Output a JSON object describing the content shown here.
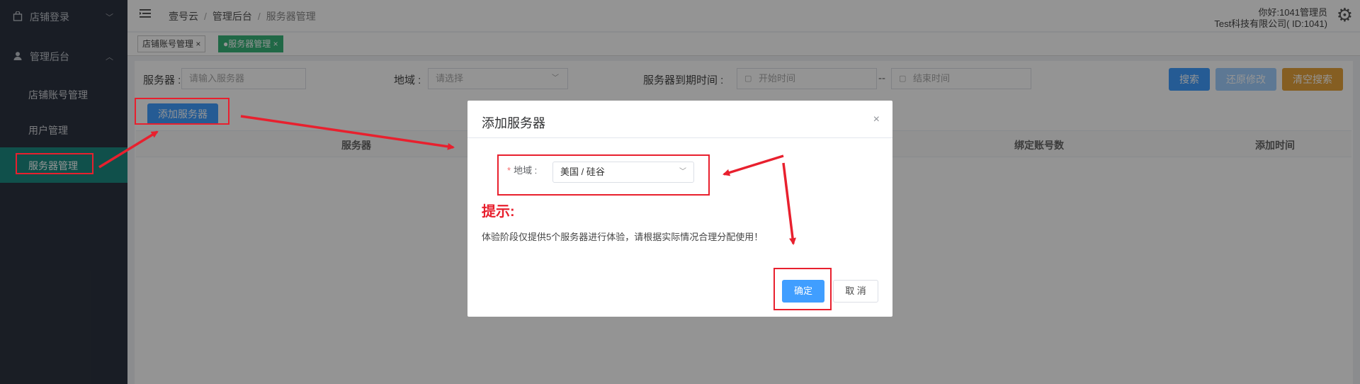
{
  "sidebar": {
    "groups": [
      {
        "label": "店铺登录",
        "icon": "bag-icon"
      },
      {
        "label": "管理后台",
        "icon": "user-icon"
      }
    ],
    "sub_items": [
      "店铺账号管理",
      "用户管理",
      "服务器管理"
    ]
  },
  "header": {
    "breadcrumb": [
      "壹号云",
      "管理后台",
      "服务器管理"
    ],
    "user_greeting": "你好:1041管理员",
    "company": "Test科技有限公司( ID:1041)"
  },
  "tabs": [
    {
      "label": "店铺账号管理",
      "close": "×"
    },
    {
      "label": "●服务器管理",
      "close": "×"
    }
  ],
  "search": {
    "server_label": "服务器 :",
    "server_placeholder": "请输入服务器",
    "region_label": "地域 :",
    "region_placeholder": "请选择",
    "expire_label": "服务器到期时间 :",
    "start_placeholder": "开始时间",
    "range_sep": "--",
    "end_placeholder": "结束时间",
    "search_btn": "搜索",
    "restore_btn": "还原修改",
    "clear_btn": "清空搜索"
  },
  "toolbar": {
    "add_btn": "添加服务器"
  },
  "table": {
    "headers": [
      "服务器",
      "绑定账号数",
      "添加时间"
    ]
  },
  "dialog": {
    "title": "添加服务器",
    "close": "×",
    "region_label": "地域 :",
    "region_required": "*",
    "region_value": "美国 / 硅谷",
    "hint_title": "提示:",
    "hint_text": "体验阶段仅提供5个服务器进行体验，请根据实际情况合理分配使用！",
    "ok_btn": "确定",
    "cancel_btn": "取 消"
  },
  "colors": {
    "sidebar_bg": "#2c3340",
    "active_teal": "#1c8a82",
    "primary": "#409eff",
    "warning": "#e6a23c",
    "annotation_red": "#e8202e"
  }
}
